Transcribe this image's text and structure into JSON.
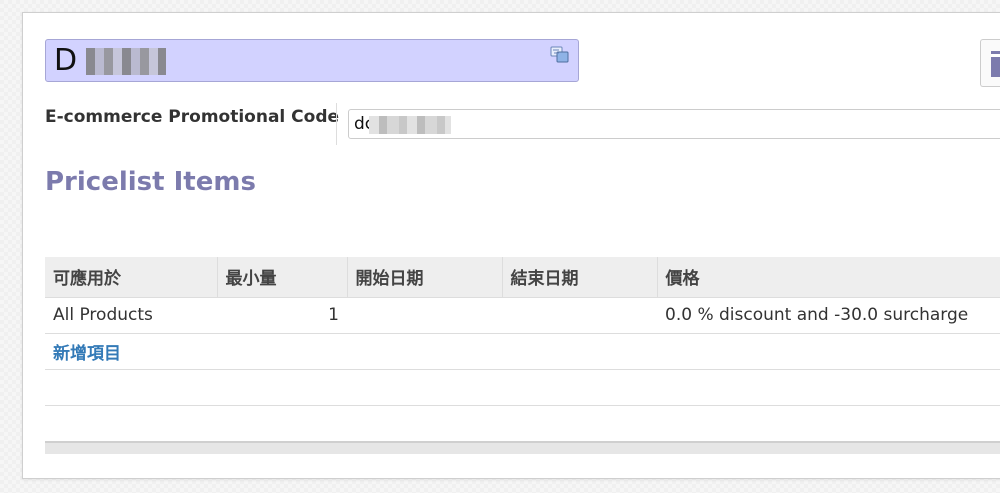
{
  "record": {
    "name_prefix": "D",
    "name_redacted": "",
    "translate_icon": "translate-icon"
  },
  "promo": {
    "label": "E-commerce Promotional Code",
    "value_prefix": "dc",
    "value_redacted": ""
  },
  "section": {
    "title": "Pricelist Items"
  },
  "table": {
    "headers": [
      "可應用於",
      "最小量",
      "開始日期",
      "結束日期",
      "價格"
    ],
    "rows": [
      [
        "All Products",
        "1",
        "",
        "",
        "0.0 % discount and -30.0 surcharge"
      ]
    ],
    "add_label": "新增項目"
  },
  "colors": {
    "accent": "#7c7bad",
    "link": "#337ab7",
    "name_bg": "#d2d2ff"
  }
}
